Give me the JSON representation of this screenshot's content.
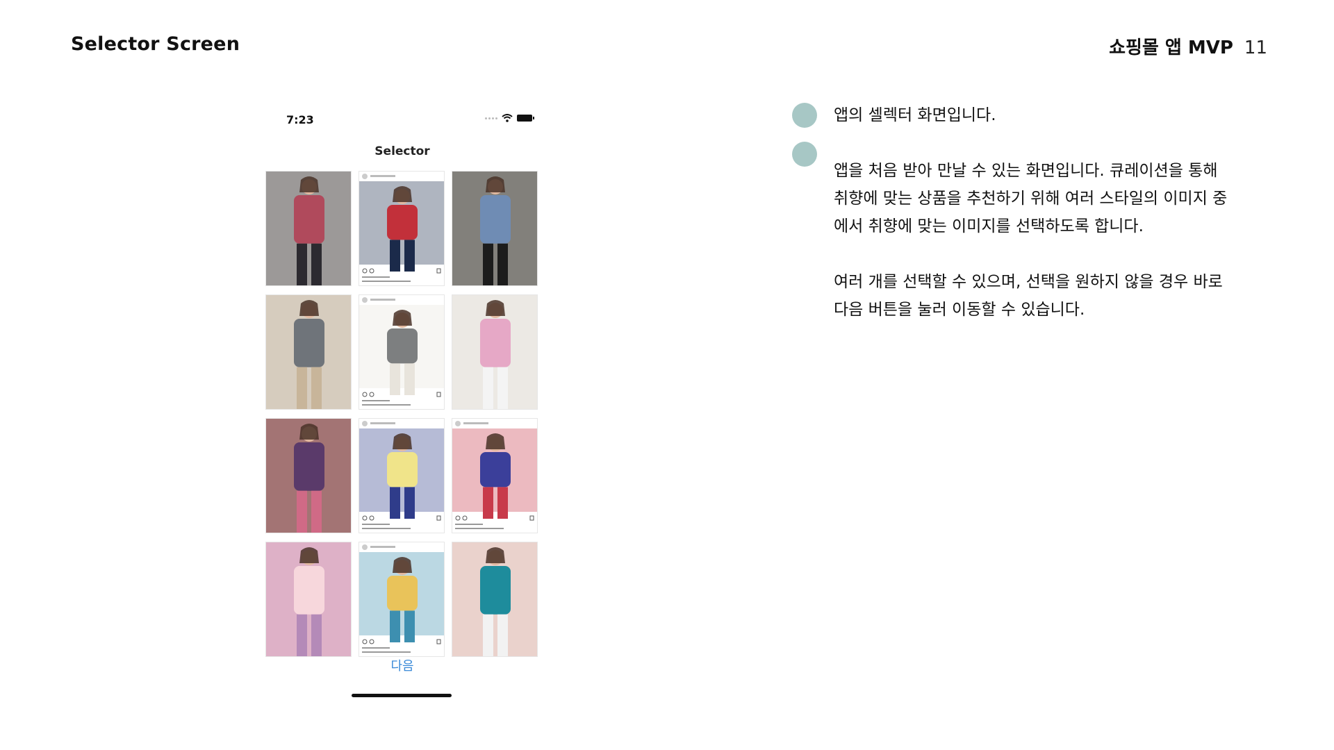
{
  "slide": {
    "title": "Selector Screen",
    "project": "쇼핑몰 앱 MVP",
    "page_number": "11"
  },
  "phone": {
    "status_time": "7:23",
    "nav_title": "Selector",
    "next_label": "다음",
    "tiles": [
      {
        "name": "striped-pants-outfit-photo",
        "bg": "#d9d4cf",
        "main": "#b04a5c",
        "accent": "#2c2a30"
      },
      {
        "name": "colorblock-jacket-photo",
        "bg": "#ffffff",
        "main": "#c2303a",
        "accent": "#1b2a4a"
      },
      {
        "name": "denim-street-outfit-photo",
        "bg": "#b8b5ae",
        "main": "#6f8cb4",
        "accent": "#1c1c1c"
      },
      {
        "name": "gray-sweatshirt-photo",
        "bg": "#ded9d2",
        "main": "#6f747a",
        "accent": "#c8b59a"
      },
      {
        "name": "mirror-selfie-hoodie-photo",
        "bg": "#ffffff",
        "main": "#7d7f80",
        "accent": "#e8e4dc"
      },
      {
        "name": "pink-knit-top-photo",
        "bg": "#e8e3dc",
        "main": "#e6a8c6",
        "accent": "#f4f4f4"
      },
      {
        "name": "floral-dress-photo",
        "bg": "#8a7a6a",
        "main": "#5a3a6a",
        "accent": "#d06a86"
      },
      {
        "name": "yellow-floral-skirt-photo",
        "bg": "#ffffff",
        "main": "#f0e48a",
        "accent": "#2f3c8a"
      },
      {
        "name": "plaid-shirt-photo",
        "bg": "#ffffff",
        "main": "#3b3f9a",
        "accent": "#c83a4a"
      },
      {
        "name": "pink-graphic-tee-photo",
        "bg": "#f5c6cf",
        "main": "#f7d7dc",
        "accent": "#b48ab8"
      },
      {
        "name": "yellow-shirt-photo",
        "bg": "#ffffff",
        "main": "#e9c35a",
        "accent": "#3d8fb0"
      },
      {
        "name": "flower-cardigan-photo",
        "bg": "#e7c2b8",
        "main": "#1e8c9c",
        "accent": "#f2f2f2"
      }
    ]
  },
  "description": {
    "line1": "앱의 셀렉터 화면입니다.",
    "para1": "앱을 처음 받아 만날 수 있는 화면입니다. 큐레이션을 통해 취향에 맞는 상품을 추천하기 위해 여러 스타일의 이미지 중에서 취향에 맞는 이미지를 선택하도록 합니다.",
    "para2": "여러 개를 선택할 수 있으며, 선택을 원하지 않을 경우 바로 다음 버튼을 눌러 이동할 수 있습니다."
  },
  "colors": {
    "bullet": "#a7c7c5",
    "link": "#3a8ad8"
  }
}
